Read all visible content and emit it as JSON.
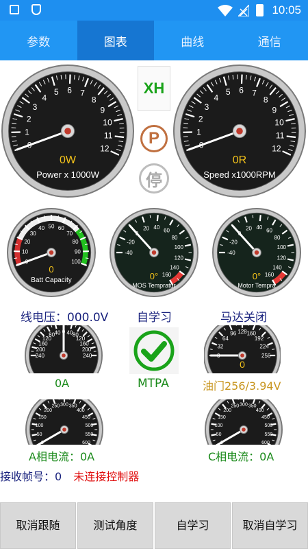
{
  "status_bar": {
    "time": "10:05"
  },
  "tabs": [
    {
      "label": "参数",
      "active": false
    },
    {
      "label": "图表",
      "active": true
    },
    {
      "label": "曲线",
      "active": false
    },
    {
      "label": "通信",
      "active": false
    }
  ],
  "power_gauge": {
    "ticks": [
      "0",
      "1",
      "2",
      "3",
      "4",
      "5",
      "6",
      "7",
      "8",
      "9",
      "10",
      "11",
      "12"
    ],
    "value_text": "0W",
    "label": "Power x 1000W",
    "value": 0
  },
  "speed_gauge": {
    "ticks": [
      "0",
      "1",
      "2",
      "3",
      "4",
      "5",
      "6",
      "7",
      "8",
      "9",
      "10",
      "11",
      "12"
    ],
    "value_text": "0R",
    "label": "Speed x1000RPM",
    "value": 0
  },
  "indicators": {
    "xh": "XH",
    "park": "P",
    "stop": "停"
  },
  "batt_gauge": {
    "ticks": [
      "0",
      "10",
      "20",
      "30",
      "40",
      "50",
      "60",
      "70",
      "80",
      "90",
      "100"
    ],
    "value_text": "0",
    "label": "Batt Capacity",
    "value": 0
  },
  "mos_gauge": {
    "ticks": [
      "-40",
      "-20",
      "0",
      "20",
      "40",
      "60",
      "80",
      "100",
      "120",
      "140",
      "160"
    ],
    "value_text": "0°",
    "label": "MOS Tempratur",
    "value": 0
  },
  "motor_gauge": {
    "ticks": [
      "-40",
      "-20",
      "0",
      "20",
      "40",
      "60",
      "80",
      "100",
      "120",
      "140",
      "160"
    ],
    "value_text": "0°",
    "label": "Motor Tempra",
    "value": 0
  },
  "info": {
    "line_voltage": "线电压：000.0V",
    "self_learn": "自学习",
    "motor_state": "马达关闭"
  },
  "current_gauge": {
    "ticks": [
      "240",
      "200",
      "160",
      "120",
      "80",
      "40",
      "0",
      "40",
      "80",
      "120",
      "160",
      "200",
      "240"
    ],
    "caption": "0A",
    "value": 0
  },
  "mtpa": {
    "label": "MTPA"
  },
  "throttle_gauge": {
    "ticks": [
      "0",
      "32",
      "64",
      "96",
      "128",
      "160",
      "192",
      "224",
      "256"
    ],
    "value_text": "0",
    "caption": "油门256/3.94V",
    "value": 0
  },
  "a_phase_gauge": {
    "ticks": [
      "0",
      "50",
      "100",
      "150",
      "200",
      "250",
      "300",
      "350",
      "400",
      "450",
      "500",
      "550",
      "600"
    ],
    "caption": "A相电流：0A",
    "value": 0
  },
  "c_phase_gauge": {
    "ticks": [
      "0",
      "50",
      "100",
      "150",
      "200",
      "250",
      "300",
      "350",
      "400",
      "450",
      "500",
      "550",
      "600"
    ],
    "caption": "C相电流：0A",
    "value": 0
  },
  "frame": {
    "label": "接收帧号：",
    "value": "0",
    "connection": "未连接控制器"
  },
  "buttons": [
    "取消跟随",
    "测试角度",
    "自学习",
    "取消自学习"
  ],
  "colors": {
    "tabbar": "#2196f3",
    "tab_active": "#1676d2",
    "green": "#1a8a1a",
    "navy": "#1a237e",
    "orange": "#c8951f",
    "red": "#e01010"
  }
}
